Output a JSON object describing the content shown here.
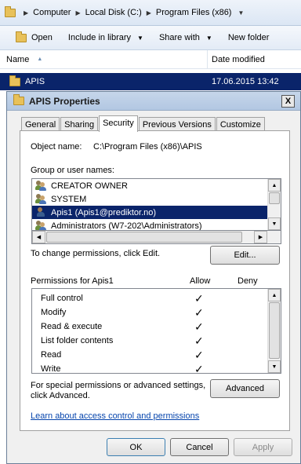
{
  "explorer": {
    "breadcrumbs": [
      "Computer",
      "Local Disk (C:)",
      "Program Files (x86)"
    ],
    "toolbar": {
      "open": "Open",
      "include": "Include in library",
      "share": "Share with",
      "newfolder": "New folder"
    },
    "columns": {
      "name": "Name",
      "date": "Date modified"
    },
    "selected_row": {
      "name": "APIS",
      "date": "17.06.2015 13:42"
    }
  },
  "dialog": {
    "title": "APIS Properties",
    "close": "X",
    "tabs": [
      "General",
      "Sharing",
      "Security",
      "Previous Versions",
      "Customize"
    ],
    "active_tab": "Security",
    "object_name_label": "Object name:",
    "object_name_value": "C:\\Program Files (x86)\\APIS",
    "group_label": "Group or user names:",
    "users": [
      {
        "name": "CREATOR OWNER",
        "icon": "group-icon"
      },
      {
        "name": "SYSTEM",
        "icon": "group-icon"
      },
      {
        "name": "Apis1 (Apis1@prediktor.no)",
        "icon": "user-icon",
        "selected": true
      },
      {
        "name": "Administrators (W7-202\\Administrators)",
        "icon": "group-icon"
      }
    ],
    "change_perm_text": "To change permissions, click Edit.",
    "edit_button": "Edit...",
    "perm_for_label": "Permissions for Apis1",
    "allow_label": "Allow",
    "deny_label": "Deny",
    "permissions": [
      {
        "name": "Full control",
        "allow": "✓"
      },
      {
        "name": "Modify",
        "allow": "✓"
      },
      {
        "name": "Read & execute",
        "allow": "✓"
      },
      {
        "name": "List folder contents",
        "allow": "✓"
      },
      {
        "name": "Read",
        "allow": "✓"
      },
      {
        "name": "Write",
        "allow": "✓"
      }
    ],
    "special_text_1": "For special permissions or advanced settings,",
    "special_text_2": "click Advanced.",
    "advanced_button": "Advanced",
    "learn_link": "Learn about access control and permissions",
    "ok_button": "OK",
    "cancel_button": "Cancel",
    "apply_button": "Apply"
  }
}
